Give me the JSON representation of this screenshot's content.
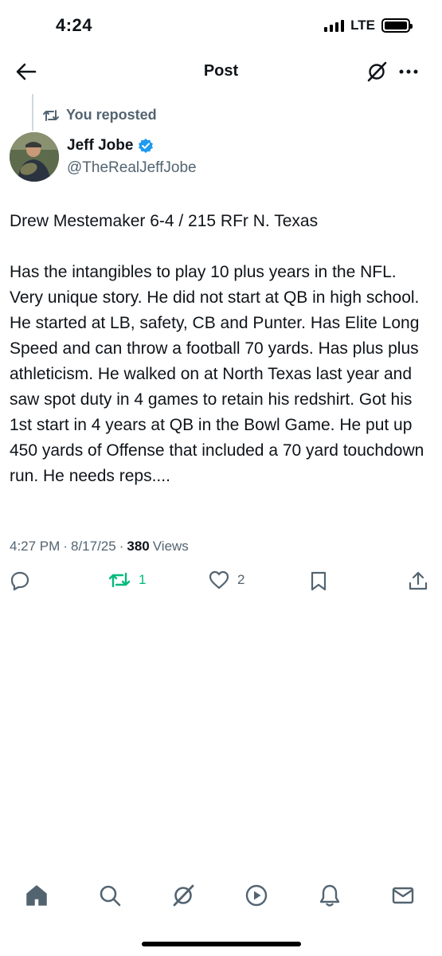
{
  "status_bar": {
    "time": "4:24",
    "network": "LTE"
  },
  "header": {
    "title": "Post"
  },
  "repost": {
    "label": "You reposted"
  },
  "author": {
    "name": "Jeff Jobe",
    "handle": "@TheRealJeffJobe"
  },
  "post": {
    "text": "Drew Mestemaker 6-4 / 215 RFr N. Texas\n\nHas the intangibles to play 10 plus years in the NFL. Very unique story. He did not start at QB in high school. He started at LB, safety, CB and Punter. Has Elite Long Speed and can throw a football 70 yards. Has plus plus athleticism. He walked on at North Texas last year and saw spot duty in 4 games to retain his redshirt. Got his 1st start in 4 years at QB in the Bowl Game. He put up 450 yards of Offense that included a 70 yard touchdown run. He needs reps....",
    "time": "4:27 PM",
    "date": "8/17/25",
    "views_count": "380",
    "views_label": "Views"
  },
  "actions": {
    "reposts": "1",
    "likes": "2"
  },
  "colors": {
    "repost_green": "#00ba7c",
    "muted": "#536471",
    "verified_blue": "#1d9bf0"
  },
  "icons": [
    "back-arrow-icon",
    "grok-icon",
    "more-icon",
    "repost-icon",
    "verified-badge-icon",
    "reply-icon",
    "like-icon",
    "bookmark-icon",
    "share-icon",
    "home-icon",
    "search-icon",
    "play-icon",
    "bell-icon",
    "mail-icon"
  ]
}
